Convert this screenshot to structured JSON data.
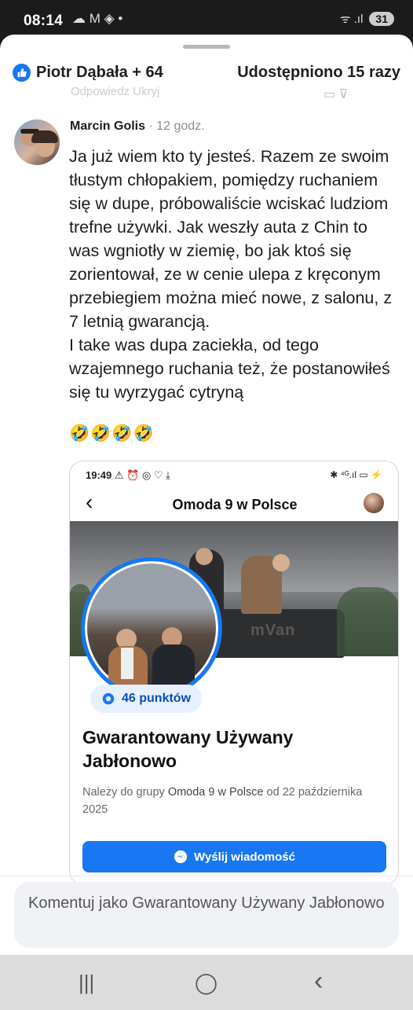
{
  "status_bar": {
    "time": "08:14",
    "notification_icons": "☁ M ◈ •",
    "signal_text": "ᯤ .ıl",
    "battery": "31"
  },
  "reactions": {
    "summary": "Piotr Dąbała + 64",
    "shares": "Udostępniono 15 razy"
  },
  "faded_actions": {
    "left": "Odpowiedz   Ukryj",
    "right": "▭    ⊽"
  },
  "comment": {
    "author": "Marcin Golis",
    "time": "· 12 godz.",
    "text": "Ja już wiem kto ty jesteś. Razem ze swoim tłustym chłopakiem, pomiędzy ruchaniem się w dupe, próbowaliście wciskać ludziom trefne używki. Jak weszły auta z Chin to was wgniotły w ziemię, bo jak ktoś się zorientował, ze w cenie ulepa z kręconym przebiegiem można mieć nowe, z salonu, z 7 letnią gwarancją.\nI take was dupa zaciekła, od tego wzajemnego ruchania też, że postanowiłeś się tu wyrzygać cytryną",
    "emojis": "🤣🤣🤣🤣"
  },
  "screenshot": {
    "status_time": "19:49",
    "status_icons": "⚠ ⏰ ◎ ♡ ⤓",
    "status_right": "✱ ⁴ᴳ.ıl ▭ ⚡",
    "header_title": "Omoda 9 w Polsce",
    "cover_text": "mVan",
    "points": "46 punktów",
    "group_name": "Gwarantowany Używany Jabłonowo",
    "meta_prefix": "Należy do grupy ",
    "meta_group": "Omoda 9 w Polsce",
    "meta_suffix": " od 22 października 2025",
    "send_button": "Wyślij wiadomość"
  },
  "comment_input": {
    "placeholder": "Komentuj jako Gwarantowany Używany Jabłonowo"
  },
  "nav": {
    "recents": "|||",
    "home": "◯",
    "back": "‹"
  },
  "colors": {
    "facebook_blue": "#1877f2",
    "badge_bg": "#e7f0ff",
    "input_bg": "#f0f2f5"
  }
}
